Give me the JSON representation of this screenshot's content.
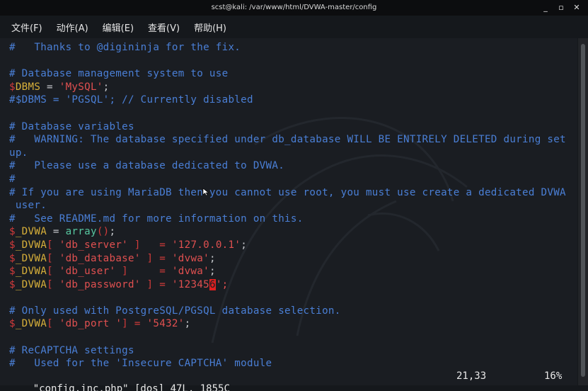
{
  "window": {
    "title": "scst@kali: /var/www/html/DVWA-master/config",
    "buttons": [
      "_",
      "▫",
      "✕"
    ]
  },
  "menu": [
    "文件(F)",
    "动作(A)",
    "编辑(E)",
    "查看(V)",
    "帮助(H)"
  ],
  "code": {
    "l0": "#   Thanks to @digininja for the fix.",
    "l2": "# Database management system to use",
    "l3a": "$",
    "l3b": "DBMS",
    "l3c": " = ",
    "l3d": "'MySQL'",
    "l3e": ";",
    "l4": "#$DBMS = 'PGSQL'; // Currently disabled",
    "l6": "# Database variables",
    "l7": "#   WARNING: The database specified under db_database WILL BE ENTIRELY DELETED during set",
    "l8": "up.",
    "l9": "#   Please use a database dedicated to DVWA.",
    "l10": "#",
    "l11": "# If you are using MariaDB then you cannot use root, you must use create a dedicated DVWA",
    "l12": " user.",
    "l13": "#   See README.md for more information on this.",
    "l14a": "$",
    "l14b": "_DVWA",
    "l14c": " = ",
    "l14d": "array",
    "l14e": "()",
    "l14f": ";",
    "l15a": "$",
    "l15b": "_DVWA",
    "l15c": "[ ",
    "l15d": "'db_server'",
    "l15e": " ]   = ",
    "l15f": "'127.0.0.1'",
    "l15g": ";",
    "l16a": "$",
    "l16b": "_DVWA",
    "l16c": "[ ",
    "l16d": "'db_database'",
    "l16e": " ] = ",
    "l16f": "'dvwa'",
    "l16g": ";",
    "l17a": "$",
    "l17b": "_DVWA",
    "l17c": "[ ",
    "l17d": "'db_user'",
    "l17e": " ]     = ",
    "l17f": "'dvwa'",
    "l17g": ";",
    "l18a": "$",
    "l18b": "_DVWA",
    "l18c": "[ ",
    "l18d": "'db_password'",
    "l18e": " ] = ",
    "l18f": "'12345",
    "l18cur": "6",
    "l18g": "';",
    "l20": "# Only used with PostgreSQL/PGSQL database selection.",
    "l21a": "$",
    "l21b": "_DVWA",
    "l21c": "[ ",
    "l21d": "'db_port '",
    "l21e": "] = ",
    "l21f": "'5432'",
    "l21g": ";",
    "l23": "# ReCAPTCHA settings",
    "l24": "#   Used for the 'Insecure CAPTCHA' module"
  },
  "status": {
    "file": "\"config.inc.php\" [dos] 47L, 1855C",
    "position": "21,33",
    "percent": "16%"
  }
}
